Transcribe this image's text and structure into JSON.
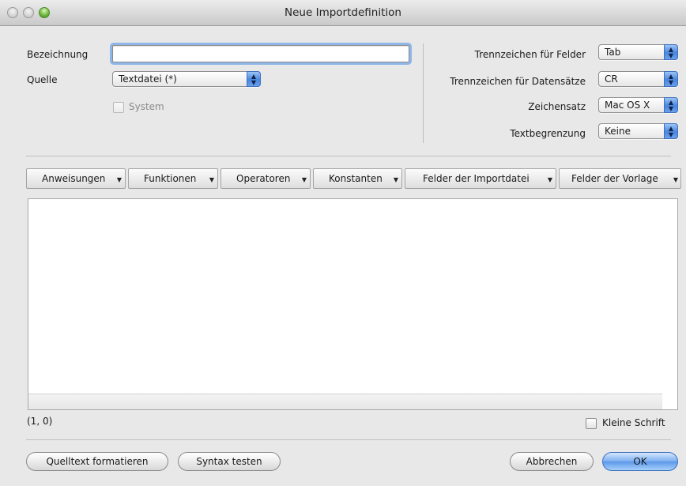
{
  "window": {
    "title": "Neue Importdefinition"
  },
  "form": {
    "bezeichnung_label": "Bezeichnung",
    "bezeichnung_value": "",
    "quelle_label": "Quelle",
    "quelle_value": "Textdatei (*)",
    "system_label": "System",
    "system_checked": false
  },
  "settings": {
    "feldtrenner_label": "Trennzeichen für Felder",
    "feldtrenner_value": "Tab",
    "datensatztrenner_label": "Trennzeichen für Datensätze",
    "datensatztrenner_value": "CR",
    "zeichensatz_label": "Zeichensatz",
    "zeichensatz_value": "Mac OS X",
    "textbegrenzung_label": "Textbegrenzung",
    "textbegrenzung_value": "Keine"
  },
  "toolbar": {
    "items": [
      "Anweisungen",
      "Funktionen",
      "Operatoren",
      "Konstanten",
      "Felder der Importdatei",
      "Felder der Vorlage"
    ]
  },
  "editor": {
    "content": "",
    "cursor_position": "(1, 0)",
    "small_font_label": "Kleine Schrift",
    "small_font_checked": false
  },
  "buttons": {
    "format": "Quelltext formatieren",
    "syntax": "Syntax testen",
    "cancel": "Abbrechen",
    "ok": "OK"
  }
}
